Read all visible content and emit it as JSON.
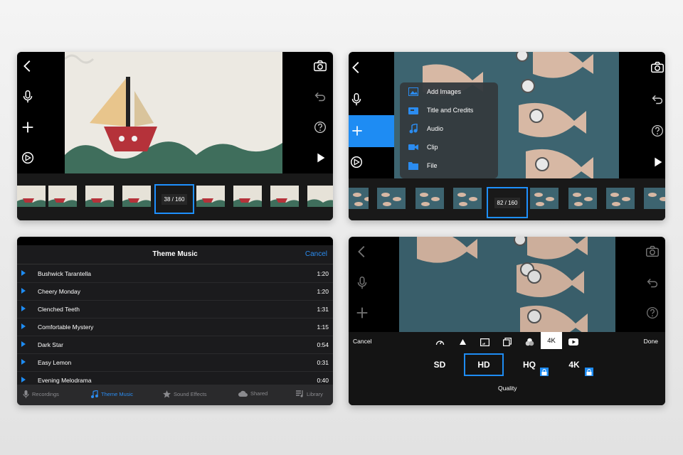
{
  "editor": {
    "counter": "38 / 160"
  },
  "add_menu": {
    "counter": "82 / 160",
    "items": [
      "Add Images",
      "Title and Credits",
      "Audio",
      "Clip",
      "File"
    ]
  },
  "theme_music": {
    "title": "Theme Music",
    "cancel": "Cancel",
    "tracks": [
      {
        "name": "Bushwick Tarantella",
        "duration": "1:20"
      },
      {
        "name": "Cheery Monday",
        "duration": "1:20"
      },
      {
        "name": "Clenched Teeth",
        "duration": "1:31"
      },
      {
        "name": "Comfortable Mystery",
        "duration": "1:15"
      },
      {
        "name": "Dark Star",
        "duration": "0:54"
      },
      {
        "name": "Easy Lemon",
        "duration": "0:31"
      },
      {
        "name": "Evening Melodrama",
        "duration": "0:40"
      }
    ],
    "tabs": [
      "Recordings",
      "Theme Music",
      "Sound Effects",
      "Shared",
      "Library"
    ],
    "active_tab": "Theme Music"
  },
  "quality": {
    "cancel": "Cancel",
    "done": "Done",
    "res_badge": "4K",
    "options": [
      "SD",
      "HD",
      "HQ",
      "4K"
    ],
    "selected": "HD",
    "label": "Quality"
  },
  "colors": {
    "accent": "#1e8cf3",
    "panel_bg": "#000000",
    "list_bg": "#1b1b1d"
  }
}
